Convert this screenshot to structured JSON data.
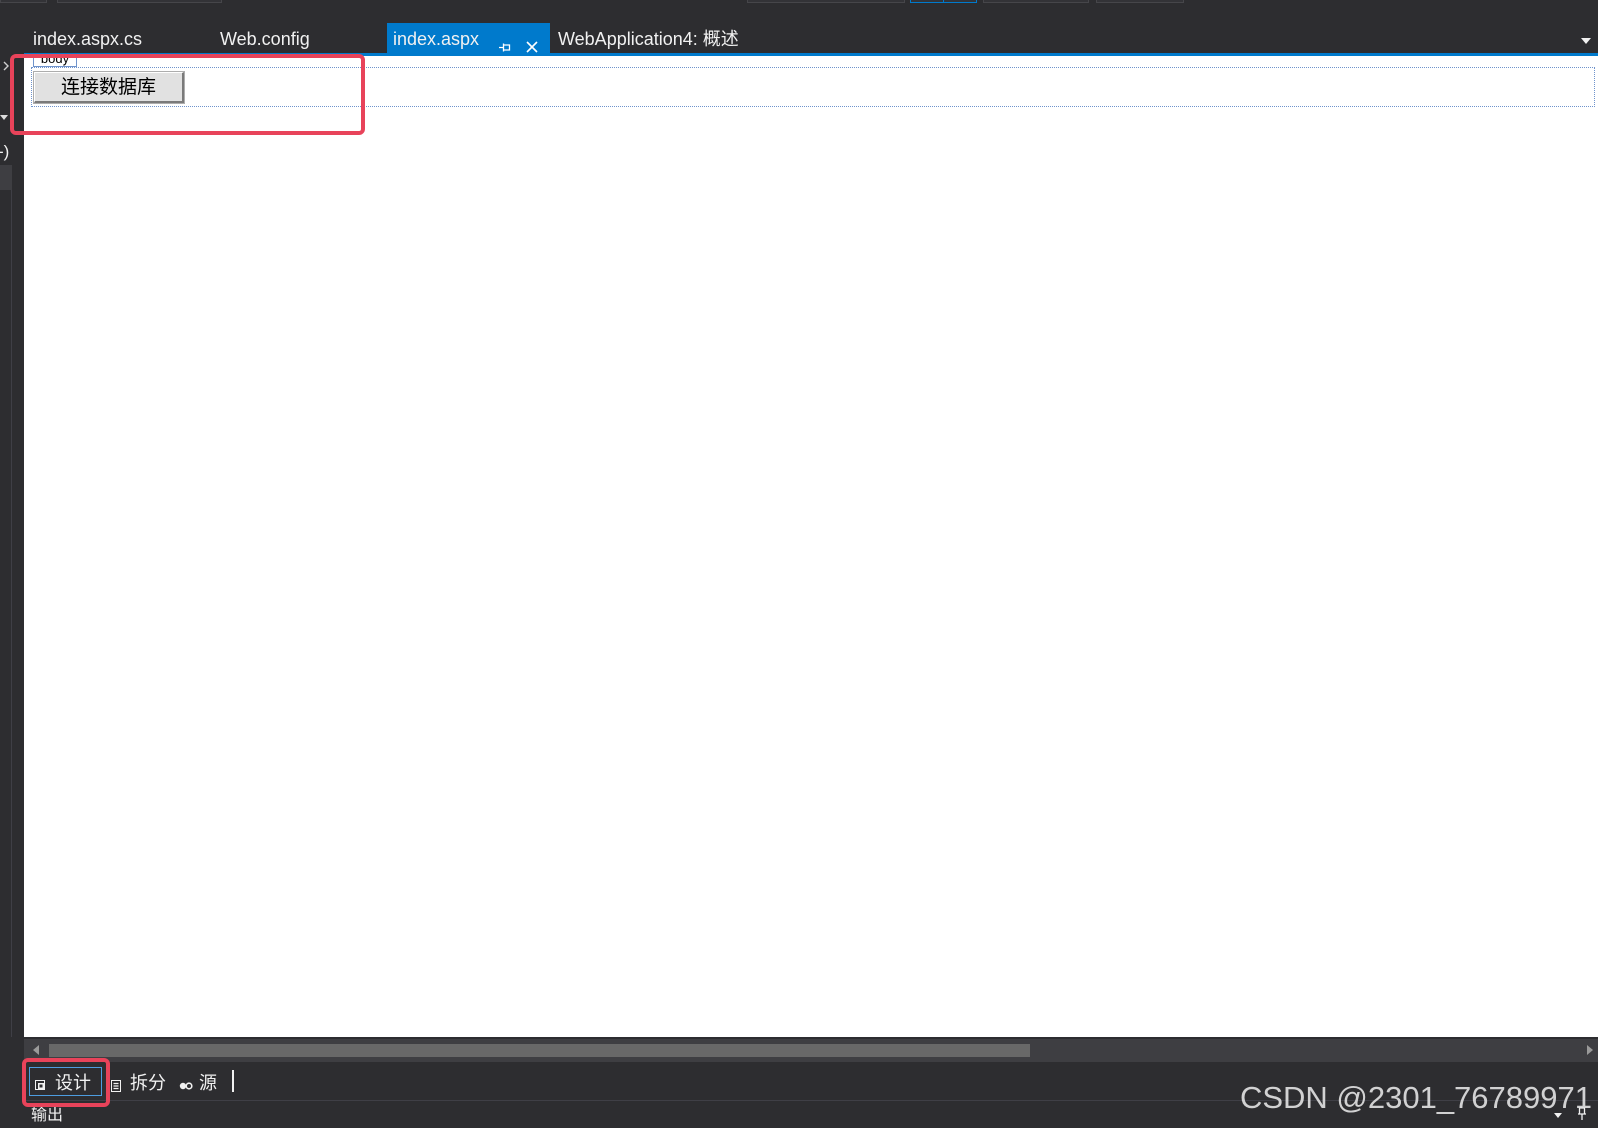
{
  "document_tabs": [
    {
      "label": "index.aspx.cs",
      "active": false
    },
    {
      "label": "Web.config",
      "active": false
    },
    {
      "label": "index.aspx",
      "active": true,
      "icons": [
        "pin-icon",
        "close-icon"
      ]
    },
    {
      "label": "WebApplication4: 概述",
      "active": false
    }
  ],
  "tab_overflow_icon": "chevron-down-icon",
  "left_panel": {
    "clipped_text": "-)",
    "icons": [
      "chevron-right-icon",
      "dropdown-triangle-icon"
    ]
  },
  "design_surface": {
    "tag_label": "body",
    "button_label": "连接数据库"
  },
  "horizontal_scrollbar": {
    "visible_fraction": 0.64,
    "scroll_fraction": 0.0
  },
  "view_tabs": [
    {
      "label": "设计",
      "icon": "design-view-icon",
      "selected": true
    },
    {
      "label": "拆分",
      "icon": "split-view-icon",
      "selected": false
    },
    {
      "label": "源",
      "icon": "source-view-icon",
      "selected": false
    }
  ],
  "output_panel": {
    "title": "输出",
    "icons": [
      "dropdown-arrow-icon",
      "pin-icon"
    ]
  },
  "watermark": "CSDN @2301_76789971",
  "colors": {
    "accent": "#007acc",
    "annotation": "#e8435a",
    "chrome": "#2d2d30",
    "surface": "#ffffff"
  }
}
